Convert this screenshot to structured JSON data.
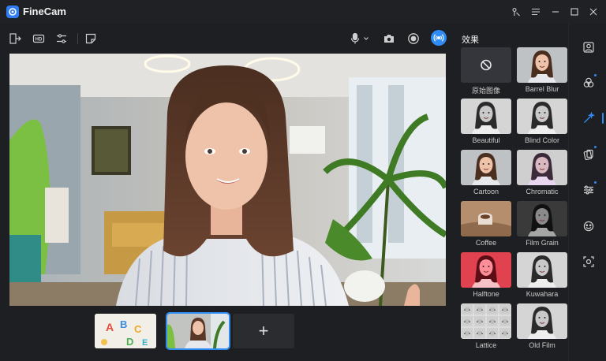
{
  "app": {
    "title": "FineCam"
  },
  "effects": {
    "title": "效果",
    "items": [
      {
        "label": "原始图像",
        "kind": "none"
      },
      {
        "label": "Barrel Blur",
        "kind": "color"
      },
      {
        "label": "Beautiful",
        "kind": "bw"
      },
      {
        "label": "Blind Color",
        "kind": "bw"
      },
      {
        "label": "Cartoon",
        "kind": "color"
      },
      {
        "label": "Chromatic",
        "kind": "chroma"
      },
      {
        "label": "Coffee",
        "kind": "coffee"
      },
      {
        "label": "Film Grain",
        "kind": "dark"
      },
      {
        "label": "Halftone",
        "kind": "red"
      },
      {
        "label": "Kuwahara",
        "kind": "bw"
      },
      {
        "label": "Lattice",
        "kind": "lattice"
      },
      {
        "label": "Old Film",
        "kind": "bw"
      }
    ]
  },
  "thumbnails": [
    {
      "name": "abc",
      "selected": false
    },
    {
      "name": "woman",
      "selected": true
    },
    {
      "name": "add",
      "label": "+"
    }
  ],
  "colors": {
    "accent": "#2f8cf4",
    "background": "#1e1f22"
  }
}
